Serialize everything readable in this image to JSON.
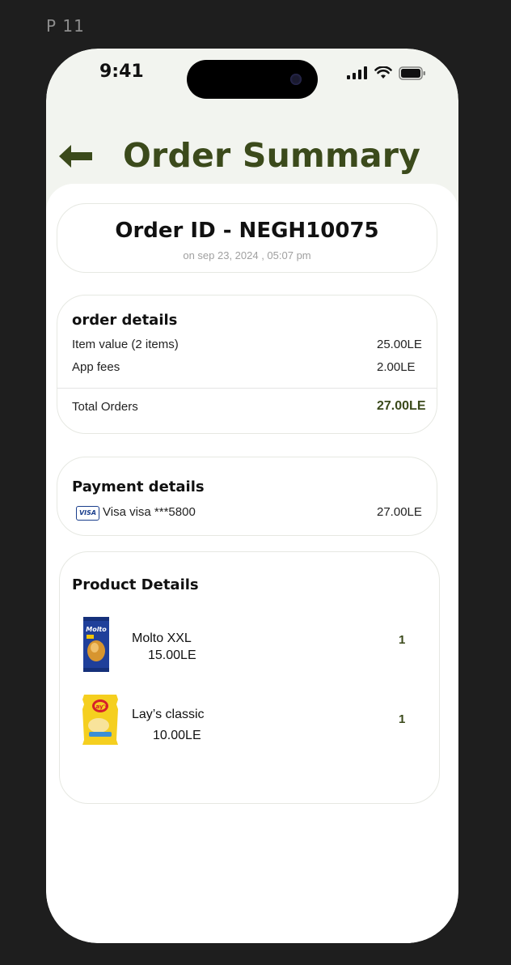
{
  "frame_label": "P 11",
  "status_bar": {
    "time": "9:41"
  },
  "header": {
    "title": "Order Summary"
  },
  "order": {
    "id_label": "Order ID - NEGH10075",
    "date_label": "on sep 23, 2024 , 05:07 pm"
  },
  "order_details": {
    "title": "order details",
    "rows": [
      {
        "label": "Item value (2 items)",
        "value": "25.00LE"
      },
      {
        "label": "App fees",
        "value": "2.00LE"
      }
    ],
    "total": {
      "label": "Total Orders",
      "value": "27.00LE"
    }
  },
  "payment_details": {
    "title": "Payment details",
    "card_badge": "VISA",
    "method": "Visa visa ***5800",
    "amount": "27.00LE"
  },
  "product_details": {
    "title": "Product Details",
    "items": [
      {
        "name": "Molto XXL",
        "price": "15.00LE",
        "qty": "1",
        "thumb_text": "Molto"
      },
      {
        "name": "Lay’s classic",
        "price": "10.00LE",
        "qty": "1",
        "thumb_text": "Lay's"
      }
    ]
  },
  "colors": {
    "accent": "#3b4a1b",
    "header_bg": "#f2f4ef",
    "page_bg": "#1e1e1e"
  }
}
